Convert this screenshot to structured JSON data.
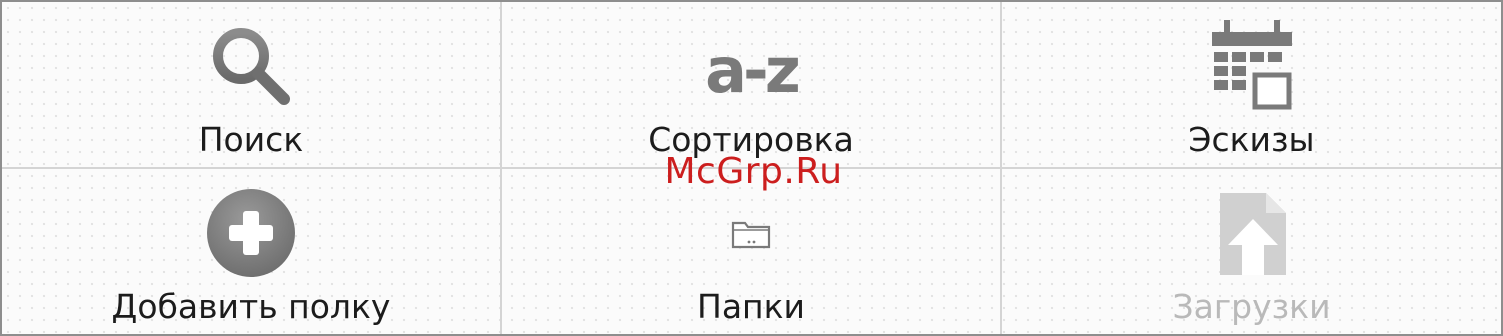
{
  "menu": {
    "items": [
      {
        "label": "Поиск",
        "icon": "search-icon",
        "enabled": true
      },
      {
        "label": "Сортировка",
        "icon": "sort-az-icon",
        "enabled": true
      },
      {
        "label": "Эскизы",
        "icon": "thumbnails-icon",
        "enabled": true
      },
      {
        "label": "Добавить полку",
        "icon": "add-circle-icon",
        "enabled": true
      },
      {
        "label": "Папки",
        "icon": "folder-icon",
        "enabled": true
      },
      {
        "label": "Загрузки",
        "icon": "download-icon",
        "enabled": false
      }
    ]
  },
  "watermark": "McGrp.Ru",
  "colors": {
    "icon_gray": "#7a7a7a",
    "icon_disabled": "#c9c9c9",
    "label": "#1c1c1c",
    "label_disabled": "#b9b9b9",
    "watermark": "#cc1e1e",
    "grid_line": "#d4d4d4",
    "border": "#8e8e8e"
  }
}
